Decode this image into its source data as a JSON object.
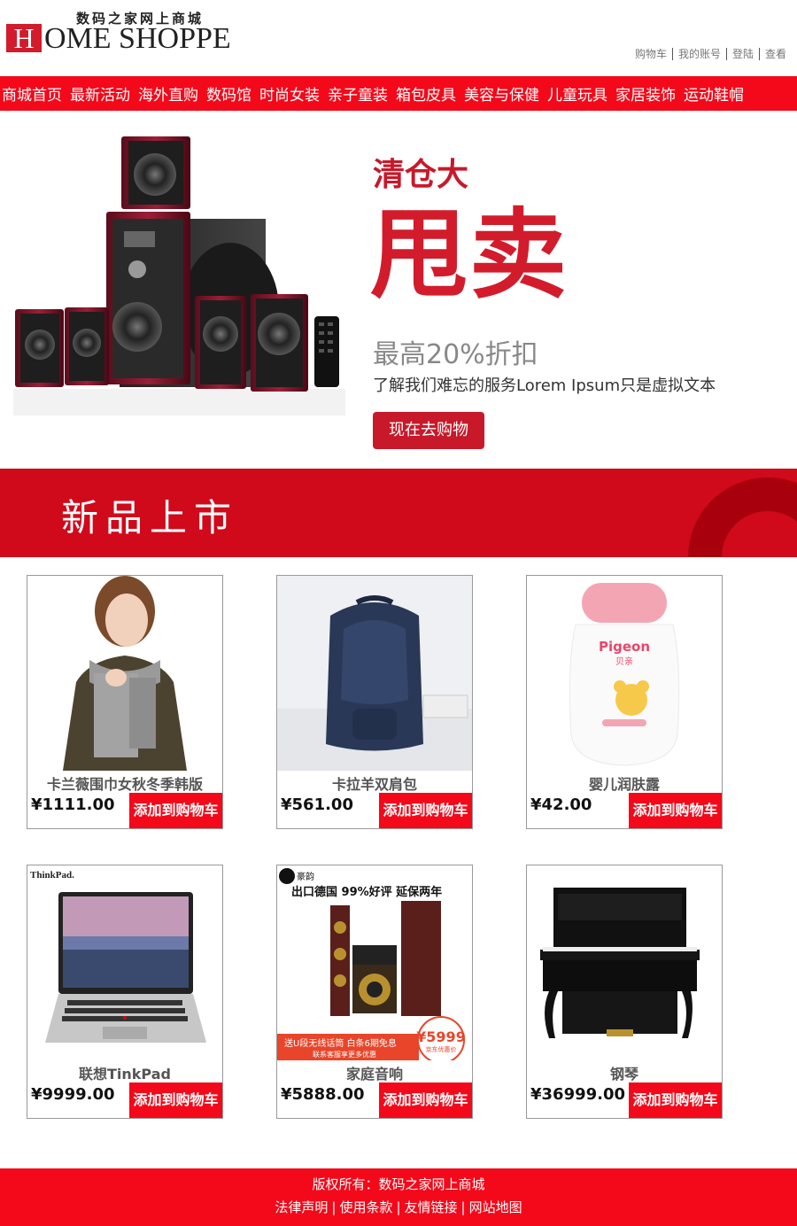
{
  "header": {
    "logo_subtitle": "数码之家网上商城",
    "logo_initial": "H",
    "logo_text": "OME SHOPPE",
    "links": [
      "购物车",
      "我的账号",
      "登陆",
      "查看"
    ]
  },
  "nav": {
    "items": [
      "商城首页",
      "最新活动",
      "海外直购",
      "数码馆",
      "时尚女装",
      "亲子童装",
      "箱包皮具",
      "美容与保健",
      "儿童玩具",
      "家居装饰",
      "运动鞋帽"
    ]
  },
  "banner": {
    "title": "清仓大",
    "big": "甩卖",
    "sub": "最高20%折扣",
    "desc": "了解我们难忘的服务Lorem Ipsum只是虚拟文本",
    "button": "现在去购物"
  },
  "section": {
    "title": "新品上市"
  },
  "products": [
    {
      "name": "卡兰薇围巾女秋冬季韩版",
      "price": "¥1111.00",
      "cart": "添加到购物车"
    },
    {
      "name": "卡拉羊双肩包",
      "price": "¥561.00",
      "cart": "添加到购物车"
    },
    {
      "name": "婴儿润肤露",
      "price": "¥42.00",
      "cart": "添加到购物车"
    },
    {
      "name": "联想TinkPad",
      "price": "¥9999.00",
      "cart": "添加到购物车"
    },
    {
      "name": "家庭音响",
      "price": "¥5888.00",
      "cart": "添加到购物车"
    },
    {
      "name": "钢琴",
      "price": "¥36999.00",
      "cart": "添加到购物车"
    }
  ],
  "product_images": {
    "lotion_brand": "Pigeon",
    "lotion_label": "贝亲",
    "laptop_brand": "ThinkPad.",
    "audio_brand": "豪韵",
    "audio_headline": "出口德国 99%好评 延保两年",
    "audio_promo": "送U段无线话筒 白条6期免息",
    "audio_promo2": "联系客服享更多优惠",
    "audio_price": "¥5999",
    "audio_price_note": "京东优惠价"
  },
  "footer": {
    "copyright": "版权所有：数码之家网上商城",
    "links": [
      "法律声明",
      "使用条款",
      "友情链接",
      "网站地图"
    ]
  },
  "colors": {
    "nav_red": "#f3091a",
    "brand_red": "#d21c2c",
    "section_red": "#d00a1b"
  }
}
